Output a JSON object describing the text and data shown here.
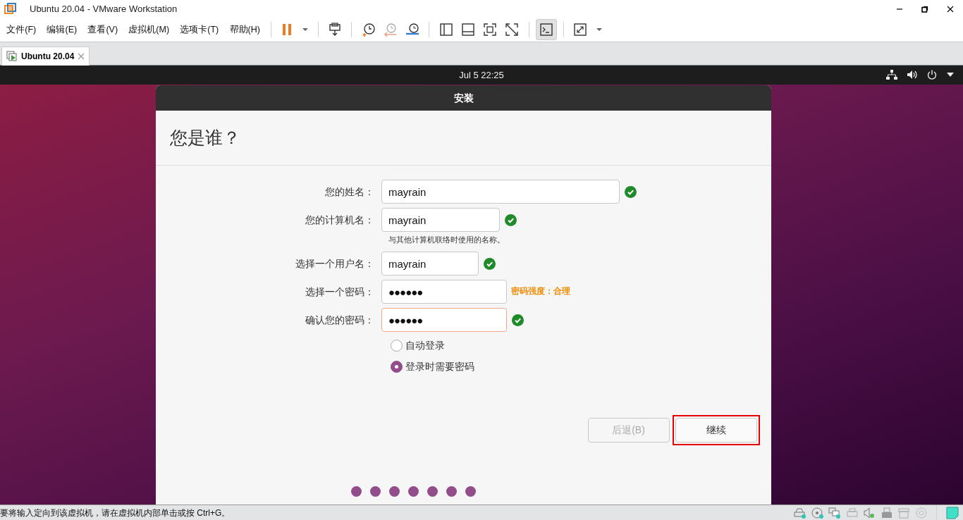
{
  "window": {
    "title": "Ubuntu 20.04 - VMware Workstation"
  },
  "menu": [
    "文件(F)",
    "编辑(E)",
    "查看(V)",
    "虚拟机(M)",
    "选项卡(T)",
    "帮助(H)"
  ],
  "tabs": [
    {
      "label": "Ubuntu 20.04",
      "selected": true
    }
  ],
  "guest_top_bar": {
    "clock": "Jul 5  22:25"
  },
  "dialog": {
    "title": "安装",
    "heading": "您是谁？",
    "fields": [
      {
        "label": "您的姓名：",
        "value": "mayrain",
        "kind": "text",
        "valid": true,
        "focused": false
      },
      {
        "label": "您的计算机名：",
        "value": "mayrain",
        "kind": "text",
        "valid": true,
        "focused": false,
        "hint": "与其他计算机联络时使用的名称。"
      },
      {
        "label": "选择一个用户名：",
        "value": "mayrain",
        "kind": "text",
        "valid": true,
        "focused": false
      },
      {
        "label": "选择一个密码：",
        "value": "●●●●●●",
        "kind": "password",
        "valid": false,
        "focused": false,
        "strength": "密码强度：合理"
      },
      {
        "label": "确认您的密码：",
        "value": "●●●●●●",
        "kind": "password",
        "valid": true,
        "focused": true
      }
    ],
    "login_options": [
      {
        "label": "自动登录",
        "selected": false
      },
      {
        "label": "登录时需要密码",
        "selected": true
      }
    ],
    "buttons": [
      {
        "label": "后退(B)",
        "disabled": true,
        "highlighted": false
      },
      {
        "label": "继续",
        "disabled": false,
        "highlighted": true
      }
    ],
    "steps": [
      {
        "done": true
      },
      {
        "done": true
      },
      {
        "done": true
      },
      {
        "done": true
      },
      {
        "done": true
      },
      {
        "done": true
      },
      {
        "done": true
      }
    ]
  },
  "status_bar": {
    "message": "要将输入定向到该虚拟机，请在虚拟机内部单击或按 Ctrl+G。"
  }
}
